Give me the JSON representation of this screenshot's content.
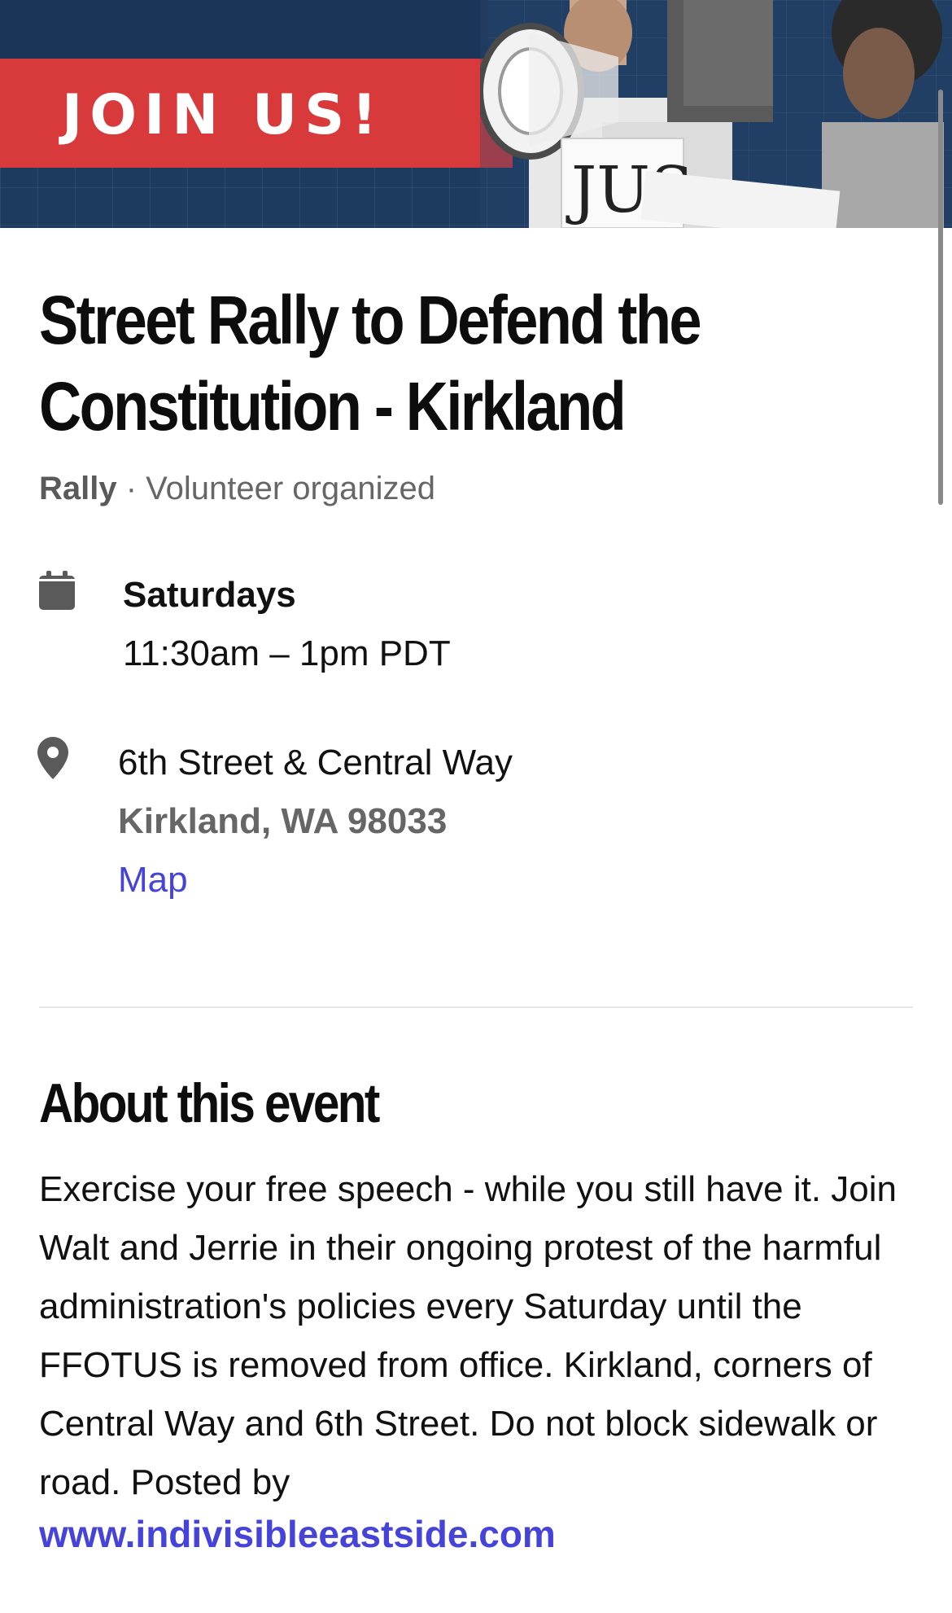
{
  "hero": {
    "banner_text": "JOIN US!",
    "sign_text": "JUS"
  },
  "event": {
    "title": "Street Rally to Defend the Constitution - Kirkland",
    "kind": "Rally",
    "separator": " · ",
    "organizer_type": "Volunteer organized"
  },
  "schedule": {
    "icon": "calendar-icon",
    "day": "Saturdays",
    "time": "11:30am – 1pm PDT"
  },
  "location": {
    "icon": "map-pin-icon",
    "street": "6th Street & Central Way",
    "city": "Kirkland, WA 98033",
    "map_link": "Map"
  },
  "about": {
    "heading": "About this event",
    "body": "Exercise your free speech - while you still have it. Join Walt and Jerrie in their ongoing protest of the harmful administration's policies every Saturday until the FFOTUS is removed from office. Kirkland, corners of Central Way and 6th Street. Do not block sidewalk or road. Posted by",
    "link": "www.indivisibleeastside.com"
  },
  "colors": {
    "accent_link": "#4543d8",
    "banner_red": "#d83a3c",
    "banner_navy": "#1d3a5f",
    "muted_text": "#666666"
  }
}
